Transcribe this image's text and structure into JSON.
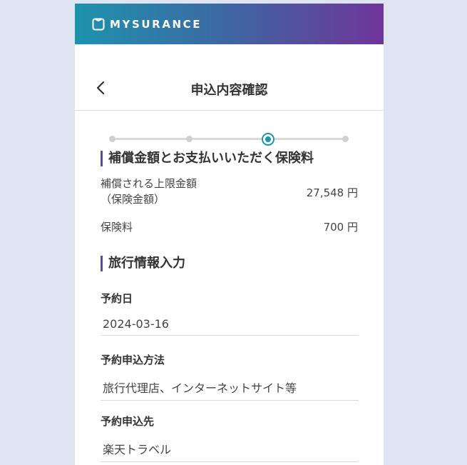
{
  "header": {
    "brand": "MYSURANCE"
  },
  "titlebar": {
    "title": "申込内容確認"
  },
  "stepper": {
    "total_steps": 4,
    "current_step": 3
  },
  "coverage": {
    "heading": "補償金額とお支払いいただく保険料",
    "limit_label_line1": "補償される上限金額",
    "limit_label_line2": "（保険金額）",
    "limit_value": "27,548 円",
    "premium_label": "保険料",
    "premium_value": "700 円"
  },
  "travel": {
    "heading": "旅行情報入力",
    "reservation_date_label": "予約日",
    "reservation_date_value": "2024-03-16",
    "method_label": "予約申込方法",
    "method_value": "旅行代理店、インターネットサイト等",
    "destination_label": "予約申込先",
    "destination_value": "楽天トラベル"
  }
}
